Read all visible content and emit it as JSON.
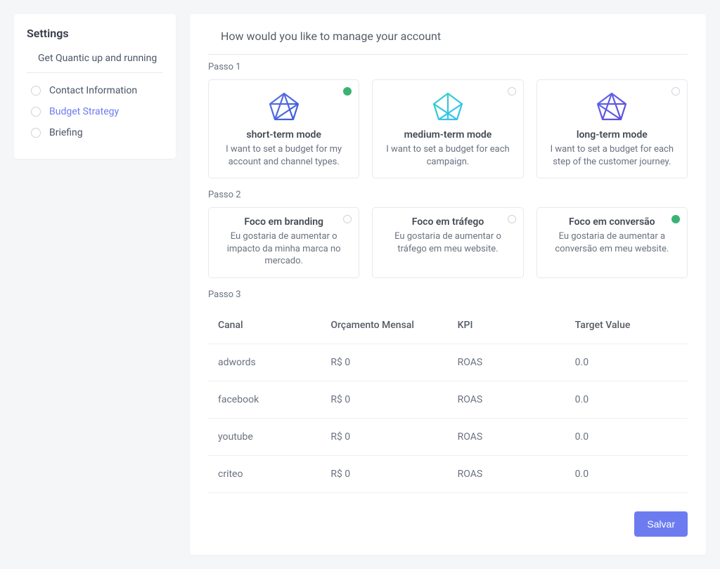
{
  "sidebar": {
    "title": "Settings",
    "subtitle": "Get Quantic up and running",
    "items": [
      {
        "label": "Contact Information",
        "active": false
      },
      {
        "label": "Budget Strategy",
        "active": true
      },
      {
        "label": "Briefing",
        "active": false
      }
    ]
  },
  "main": {
    "heading": "How would you like to manage your account",
    "step1": {
      "label": "Passo 1",
      "options": [
        {
          "title": "short-term mode",
          "desc": "I want to set a budget for my account and channel types.",
          "selected": true
        },
        {
          "title": "medium-term mode",
          "desc": "I want to set a budget for each campaign.",
          "selected": false
        },
        {
          "title": "long-term mode",
          "desc": "I want to set a budget for each step of the customer journey.",
          "selected": false
        }
      ]
    },
    "step2": {
      "label": "Passo 2",
      "options": [
        {
          "title": "Foco em branding",
          "desc": "Eu gostaria de aumentar o impacto da minha marca no mercado.",
          "selected": false
        },
        {
          "title": "Foco em tráfego",
          "desc": "Eu gostaria de aumentar o tráfego em meu website.",
          "selected": false
        },
        {
          "title": "Foco em conversão",
          "desc": "Eu gostaria de aumentar a conversão em meu website.",
          "selected": true
        }
      ]
    },
    "step3": {
      "label": "Passo 3",
      "headers": {
        "canal": "Canal",
        "orcamento": "Orçamento Mensal",
        "kpi": "KPI",
        "target": "Target Value"
      },
      "rows": [
        {
          "canal": "adwords",
          "orcamento": "R$ 0",
          "kpi": "ROAS",
          "target": "0.0"
        },
        {
          "canal": "facebook",
          "orcamento": "R$ 0",
          "kpi": "ROAS",
          "target": "0.0"
        },
        {
          "canal": "youtube",
          "orcamento": "R$ 0",
          "kpi": "ROAS",
          "target": "0.0"
        },
        {
          "canal": "criteo",
          "orcamento": "R$ 0",
          "kpi": "ROAS",
          "target": "0.0"
        }
      ]
    },
    "save_label": "Salvar"
  },
  "colors": {
    "accent": "#6c7cf0",
    "selected": "#3bb273"
  }
}
